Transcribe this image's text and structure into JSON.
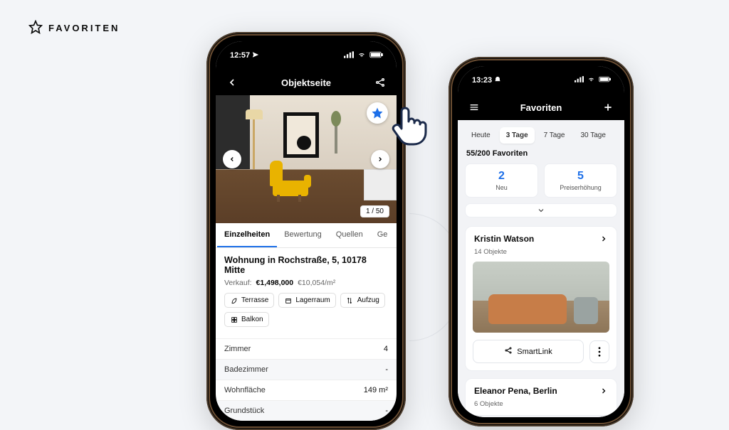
{
  "page": {
    "header_label": "FAVORITEN"
  },
  "left_phone": {
    "status": {
      "time": "12:57"
    },
    "nav": {
      "title": "Objektseite"
    },
    "hero": {
      "counter": "1 / 50",
      "counter_total": 50,
      "counter_current": 1
    },
    "tabs": [
      "Einzelheiten",
      "Bewertung",
      "Quellen",
      "Ge"
    ],
    "tabs_active_index": 0,
    "listing": {
      "title": "Wohnung in Rochstraße, 5, 10178 Mitte",
      "price_label": "Verkauf:",
      "price": "€1,498,000",
      "price_sqm": "€10,054/m²"
    },
    "features": [
      {
        "icon": "leaf-icon",
        "label": "Terrasse"
      },
      {
        "icon": "box-icon",
        "label": "Lagerraum"
      },
      {
        "icon": "arrows-icon",
        "label": "Aufzug"
      },
      {
        "icon": "grid-icon",
        "label": "Balkon"
      }
    ],
    "specs": [
      {
        "label": "Zimmer",
        "value": "4"
      },
      {
        "label": "Badezimmer",
        "value": "-"
      },
      {
        "label": "Wohnfläche",
        "value": "149 m²"
      },
      {
        "label": "Grundstück",
        "value": "-"
      }
    ]
  },
  "right_phone": {
    "status": {
      "time": "13:23"
    },
    "nav": {
      "title": "Favoriten"
    },
    "filters": [
      "Heute",
      "3 Tage",
      "7 Tage",
      "30 Tage"
    ],
    "filters_active_index": 1,
    "count_line": "55/200 Favoriten",
    "count_current": 55,
    "count_total": 200,
    "stats": [
      {
        "value": "2",
        "label": "Neu"
      },
      {
        "value": "5",
        "label": "Preiserhöhung"
      }
    ],
    "cards": [
      {
        "name": "Kristin Watson",
        "subtitle": "14 Objekte",
        "smartlink_label": "SmartLink"
      },
      {
        "name": "Eleanor Pena, Berlin",
        "subtitle": "6 Objekte"
      }
    ]
  }
}
